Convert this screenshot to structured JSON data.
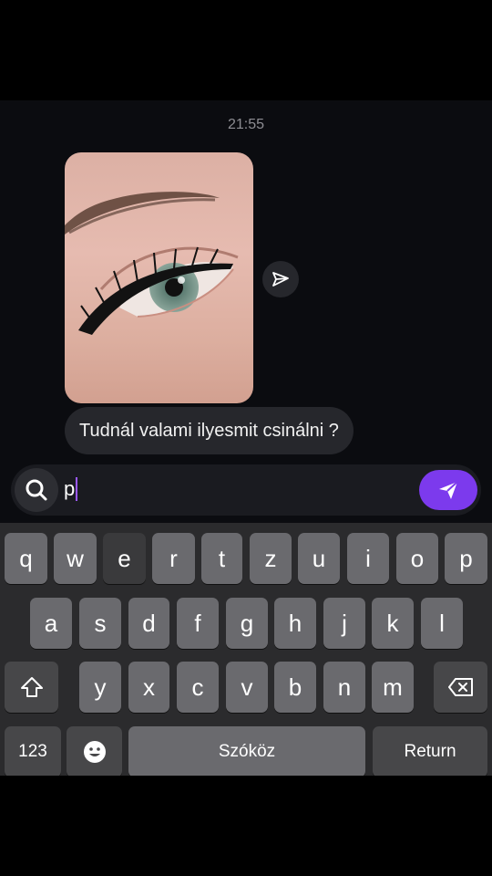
{
  "chat": {
    "timestamp": "21:55",
    "message_text": "Tudnál valami ilyesmit csinálni ?"
  },
  "composer": {
    "input_value": "p"
  },
  "keyboard": {
    "row1": [
      "q",
      "w",
      "e",
      "r",
      "t",
      "z",
      "u",
      "i",
      "o",
      "p"
    ],
    "row2": [
      "a",
      "s",
      "d",
      "f",
      "g",
      "h",
      "j",
      "k",
      "l"
    ],
    "row3": [
      "y",
      "x",
      "c",
      "v",
      "b",
      "n",
      "m"
    ],
    "numbers_label": "123",
    "space_label": "Szóköz",
    "return_label": "Return",
    "shift_icon": "shift-icon",
    "backspace_icon": "backspace-icon",
    "emoji_icon": "emoji-icon"
  },
  "colors": {
    "accent": "#7c3aed",
    "bubble": "#26272c",
    "key": "#6a6a6e",
    "key_dark": "#474749"
  }
}
